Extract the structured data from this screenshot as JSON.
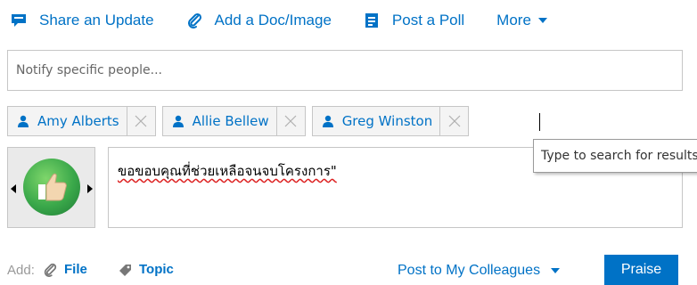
{
  "tabs": [
    {
      "label": "Share an Update",
      "icon": "speech-bubble-icon"
    },
    {
      "label": "Add a Doc/Image",
      "icon": "paperclip-icon"
    },
    {
      "label": "Post a Poll",
      "icon": "poll-icon"
    },
    {
      "label": "More",
      "icon": "chevron-down-icon"
    }
  ],
  "notify": {
    "placeholder": "Notify specific people..."
  },
  "recipients": [
    {
      "name": "Amy Alberts"
    },
    {
      "name": "Allie Bellew"
    },
    {
      "name": "Greg Winston"
    }
  ],
  "tooltip": {
    "text": "Type to search for results"
  },
  "message": {
    "text": "ขอขอบคุณที่ช่วยเหลือจนจบโครงการ\""
  },
  "avatar": {
    "icon": "thumbs-up-icon"
  },
  "footer": {
    "add_label": "Add:",
    "file_label": "File",
    "topic_label": "Topic",
    "post_to_label": "Post to My Colleagues",
    "praise_label": "Praise"
  },
  "colors": {
    "accent": "#0072c6",
    "border": "#c6c6c6",
    "muted": "#999999"
  }
}
